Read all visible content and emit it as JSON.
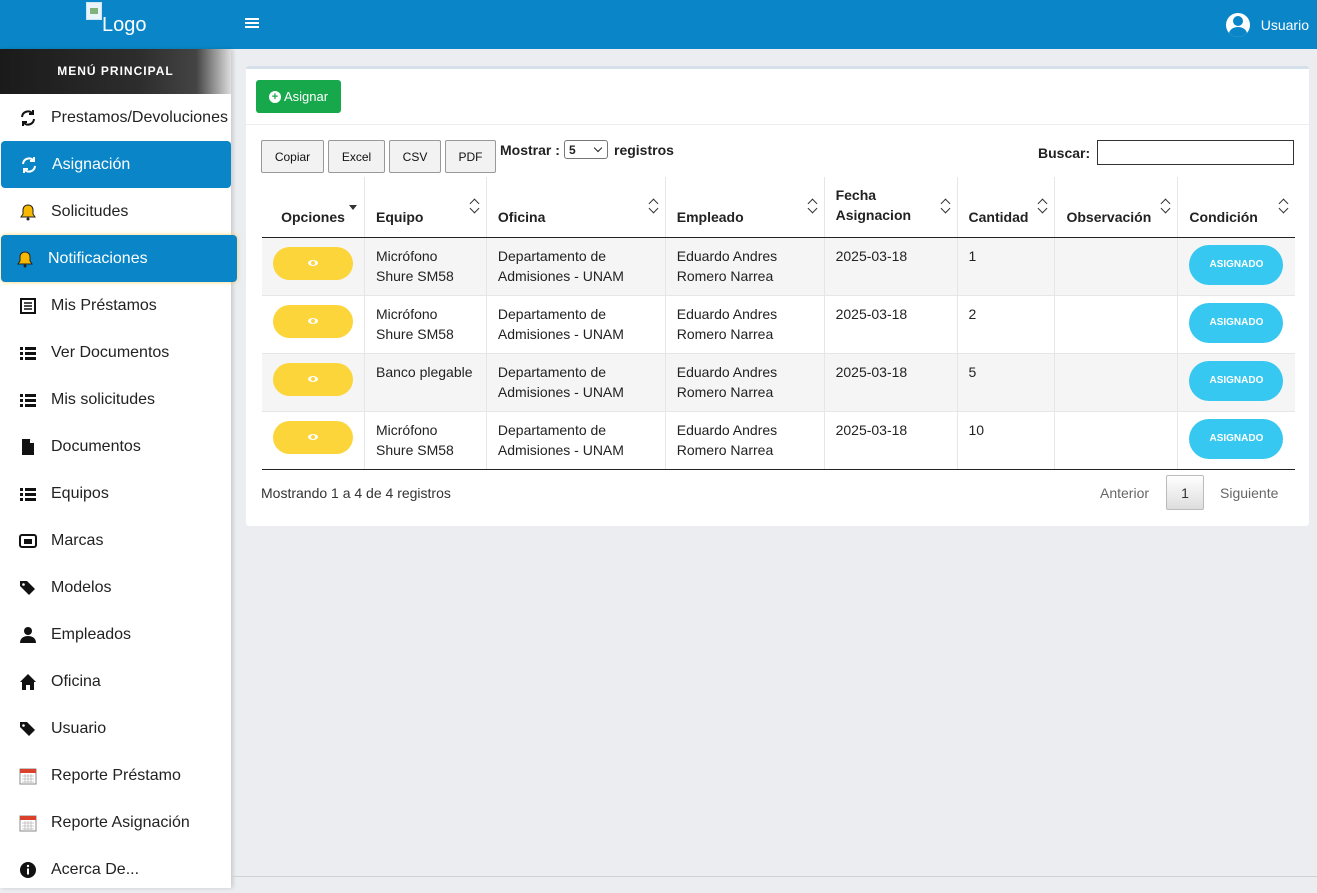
{
  "header": {
    "logo_alt": "Logo",
    "user_label": "Usuario"
  },
  "sidebar": {
    "title": "MENÚ PRINCIPAL",
    "items": [
      {
        "label": "Prestamos/Devoluciones",
        "icon": "sync-icon"
      },
      {
        "label": "Asignación",
        "icon": "sync-icon",
        "active": true
      },
      {
        "label": "Solicitudes",
        "icon": "bell-icon"
      },
      {
        "label": "Notificaciones",
        "icon": "bell-icon",
        "active": true
      },
      {
        "label": "Mis Préstamos",
        "icon": "list-alt-icon"
      },
      {
        "label": "Ver Documentos",
        "icon": "list-icon"
      },
      {
        "label": "Mis solicitudes",
        "icon": "list-icon"
      },
      {
        "label": "Documentos",
        "icon": "file-icon"
      },
      {
        "label": "Equipos",
        "icon": "list-icon"
      },
      {
        "label": "Marcas",
        "icon": "window-icon"
      },
      {
        "label": "Modelos",
        "icon": "tags-icon"
      },
      {
        "label": "Empleados",
        "icon": "user-icon"
      },
      {
        "label": "Oficina",
        "icon": "home-icon"
      },
      {
        "label": "Usuario",
        "icon": "tags-icon"
      },
      {
        "label": "Reporte Préstamo",
        "icon": "calendar-icon"
      },
      {
        "label": "Reporte Asignación",
        "icon": "calendar-icon"
      },
      {
        "label": "Acerca De...",
        "icon": "info-icon"
      }
    ]
  },
  "toolbar": {
    "assign_label": "Asignar",
    "copy_label": "Copiar",
    "excel_label": "Excel",
    "csv_label": "CSV",
    "pdf_label": "PDF",
    "show_label": "Mostrar :",
    "show_value": "5",
    "records_label": "registros",
    "search_label": "Buscar:",
    "search_value": ""
  },
  "table": {
    "columns": [
      "Opciones",
      "Equipo",
      "Oficina",
      "Empleado",
      "Fecha Asignacion",
      "Cantidad",
      "Observación",
      "Condición"
    ],
    "rows": [
      {
        "equipo": "Micrófono Shure SM58",
        "oficina": "Departamento de Admisiones - UNAM",
        "empleado": "Eduardo Andres Romero Narrea",
        "fecha": "2025-03-18",
        "cantidad": "1",
        "observacion": "",
        "condicion": "ASIGNADO"
      },
      {
        "equipo": "Micrófono Shure SM58",
        "oficina": "Departamento de Admisiones - UNAM",
        "empleado": "Eduardo Andres Romero Narrea",
        "fecha": "2025-03-18",
        "cantidad": "2",
        "observacion": "",
        "condicion": "ASIGNADO"
      },
      {
        "equipo": "Banco plegable",
        "oficina": "Departamento de Admisiones - UNAM",
        "empleado": "Eduardo Andres Romero Narrea",
        "fecha": "2025-03-18",
        "cantidad": "5",
        "observacion": "",
        "condicion": "ASIGNADO"
      },
      {
        "equipo": "Micrófono Shure SM58",
        "oficina": "Departamento de Admisiones - UNAM",
        "empleado": "Eduardo Andres Romero Narrea",
        "fecha": "2025-03-18",
        "cantidad": "10",
        "observacion": "",
        "condicion": "ASIGNADO"
      }
    ]
  },
  "pagination": {
    "info": "Mostrando 1 a 4 de 4 registros",
    "prev_label": "Anterior",
    "current_page": "1",
    "next_label": "Siguiente"
  },
  "colors": {
    "header_blue": "#0a86c8",
    "assign_green": "#17a84b",
    "view_yellow": "#fcd53a",
    "status_cyan": "#36c8f0"
  }
}
